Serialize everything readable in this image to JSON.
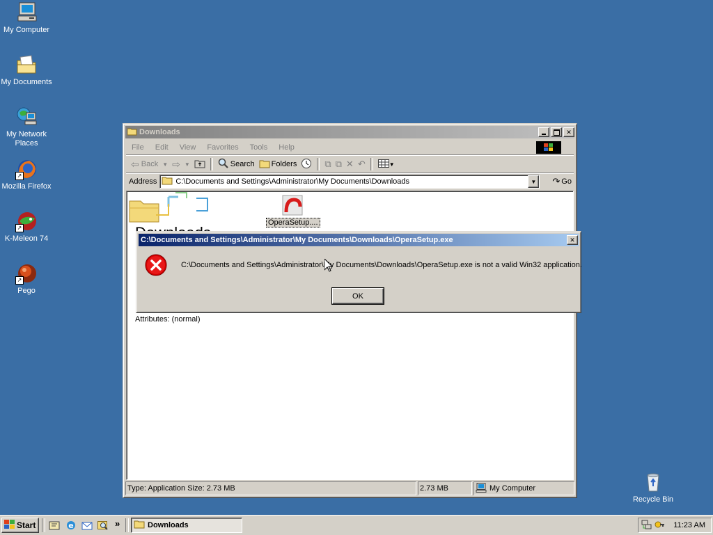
{
  "desktop": {
    "icons": [
      {
        "label": "My Computer",
        "icon": "my-computer-icon"
      },
      {
        "label": "My Documents",
        "icon": "folder-documents-icon"
      },
      {
        "label": "My Network Places",
        "icon": "network-places-icon"
      },
      {
        "label": "Mozilla Firefox",
        "icon": "firefox-icon"
      },
      {
        "label": "K-Meleon 74",
        "icon": "k-meleon-icon"
      },
      {
        "label": "Pego",
        "icon": "pego-icon"
      },
      {
        "label": "Recycle Bin",
        "icon": "recycle-bin-icon"
      }
    ]
  },
  "explorer": {
    "title": "Downloads",
    "menu": [
      "File",
      "Edit",
      "View",
      "Favorites",
      "Tools",
      "Help"
    ],
    "toolbar": {
      "back": "Back",
      "search": "Search",
      "folders": "Folders"
    },
    "address_label": "Address",
    "address_value": "C:\\Documents and Settings\\Administrator\\My Documents\\Downloads",
    "go_label": "Go",
    "folder_heading": "Downloads",
    "file_label": "OperaSetup....",
    "attributes": "Attributes: (normal)",
    "status": {
      "left": "Type: Application Size: 2.73 MB",
      "size": "2.73 MB",
      "zone": "My Computer"
    }
  },
  "dialog": {
    "title": "C:\\Documents and Settings\\Administrator\\My Documents\\Downloads\\OperaSetup.exe",
    "message": "C:\\Documents and Settings\\Administrator\\My Documents\\Downloads\\OperaSetup.exe is not a valid Win32 application.",
    "ok_label": "OK",
    "icon": "error-icon"
  },
  "taskbar": {
    "start_label": "Start",
    "task_label": "Downloads",
    "time": "11:23 AM",
    "quick_launch_overflow": "»"
  },
  "colors": {
    "desktop": "#3a6ea5",
    "active_title": "#0a246a",
    "inactive_title": "#808080",
    "error": "#d40000"
  }
}
